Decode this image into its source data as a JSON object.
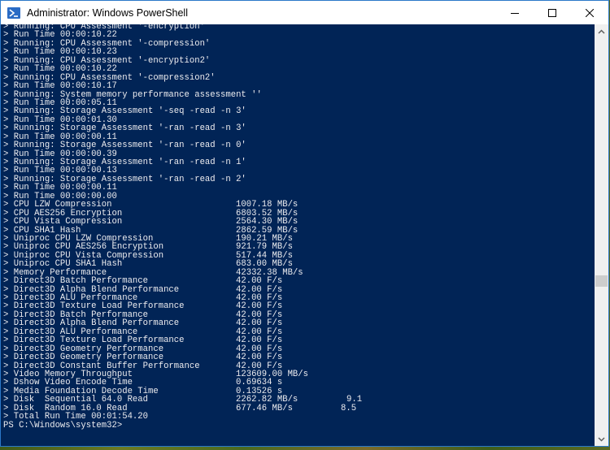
{
  "window": {
    "title": "Administrator: Windows PowerShell",
    "icon": "powershell-icon",
    "controls": [
      "minimize-icon",
      "maximize-icon",
      "close-icon"
    ]
  },
  "colors": {
    "console_bg": "#012456",
    "console_fg": "#eeedf0",
    "titlebar_bg": "#ffffff",
    "border": "#2b78c8"
  },
  "console": {
    "lines": [
      {
        "text": "> Running: CPU Assessment '-encryption'"
      },
      {
        "text": "> Run Time 00:00:10.22"
      },
      {
        "text": "> Running: CPU Assessment '-compression'"
      },
      {
        "text": "> Run Time 00:00:10.23"
      },
      {
        "text": "> Running: CPU Assessment '-encryption2'"
      },
      {
        "text": "> Run Time 00:00:10.22"
      },
      {
        "text": "> Running: CPU Assessment '-compression2'"
      },
      {
        "text": "> Run Time 00:00:10.17"
      },
      {
        "text": "> Running: System memory performance assessment ''"
      },
      {
        "text": "> Run Time 00:00:05.11"
      },
      {
        "text": "> Running: Storage Assessment '-seq -read -n 3'"
      },
      {
        "text": "> Run Time 00:00:01.30"
      },
      {
        "text": "> Running: Storage Assessment '-ran -read -n 3'"
      },
      {
        "text": "> Run Time 00:00:00.11"
      },
      {
        "text": "> Running: Storage Assessment '-ran -read -n 0'"
      },
      {
        "text": "> Run Time 00:00:00.39"
      },
      {
        "text": "> Running: Storage Assessment '-ran -read -n 1'"
      },
      {
        "text": "> Run Time 00:00:00.13"
      },
      {
        "text": "> Running: Storage Assessment '-ran -read -n 2'"
      },
      {
        "text": "> Run Time 00:00:00.11"
      },
      {
        "text": "> Run Time 00:00:00.00"
      },
      {
        "text": "> CPU LZW Compression",
        "value": "1007.18 MB/s"
      },
      {
        "text": "> CPU AES256 Encryption",
        "value": "6803.52 MB/s"
      },
      {
        "text": "> CPU Vista Compression",
        "value": "2564.30 MB/s"
      },
      {
        "text": "> CPU SHA1 Hash",
        "value": "2862.59 MB/s"
      },
      {
        "text": "> Uniproc CPU LZW Compression",
        "value": "190.21 MB/s"
      },
      {
        "text": "> Uniproc CPU AES256 Encryption",
        "value": "921.79 MB/s"
      },
      {
        "text": "> Uniproc CPU Vista Compression",
        "value": "517.44 MB/s"
      },
      {
        "text": "> Uniproc CPU SHA1 Hash",
        "value": "683.00 MB/s"
      },
      {
        "text": "> Memory Performance",
        "value": "42332.38 MB/s"
      },
      {
        "text": "> Direct3D Batch Performance",
        "value": "42.00 F/s"
      },
      {
        "text": "> Direct3D Alpha Blend Performance",
        "value": "42.00 F/s"
      },
      {
        "text": "> Direct3D ALU Performance",
        "value": "42.00 F/s"
      },
      {
        "text": "> Direct3D Texture Load Performance",
        "value": "42.00 F/s"
      },
      {
        "text": "> Direct3D Batch Performance",
        "value": "42.00 F/s"
      },
      {
        "text": "> Direct3D Alpha Blend Performance",
        "value": "42.00 F/s"
      },
      {
        "text": "> Direct3D ALU Performance",
        "value": "42.00 F/s"
      },
      {
        "text": "> Direct3D Texture Load Performance",
        "value": "42.00 F/s"
      },
      {
        "text": "> Direct3D Geometry Performance",
        "value": "42.00 F/s"
      },
      {
        "text": "> Direct3D Geometry Performance",
        "value": "42.00 F/s"
      },
      {
        "text": "> Direct3D Constant Buffer Performance",
        "value": "42.00 F/s"
      },
      {
        "text": "> Video Memory Throughput",
        "value": "123609.00 MB/s"
      },
      {
        "text": "> Dshow Video Encode Time",
        "value": "0.69634 s"
      },
      {
        "text": "> Media Foundation Decode Time",
        "value": "0.13526 s"
      },
      {
        "text": "> Disk  Sequential 64.0 Read",
        "value": "2262.82 MB/s",
        "score": "9.1"
      },
      {
        "text": "> Disk  Random 16.0 Read",
        "value": "677.46 MB/s",
        "score": "8.5"
      },
      {
        "text": "> Total Run Time 00:01:54.20"
      },
      {
        "text": "PS C:\\Windows\\system32>"
      }
    ]
  },
  "scrollbar": {
    "up_icon": "chevron-up-icon",
    "down_icon": "chevron-down-icon",
    "position_fraction": 0.62
  }
}
